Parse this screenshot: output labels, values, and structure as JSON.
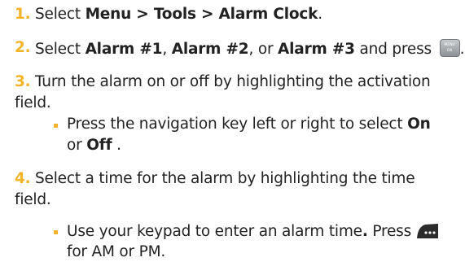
{
  "steps": [
    {
      "number": "1.",
      "pre": "Select ",
      "bold": "Menu > Tools > Alarm Clock",
      "post": "."
    },
    {
      "number": "2.",
      "t1": "Select ",
      "b1": "Alarm #1",
      "t2": ", ",
      "b2": "Alarm #2",
      "t3": ", or ",
      "b3": "Alarm #3",
      "t4": " and press ",
      "t5": ".",
      "key_icon": "menu-ok-key-icon",
      "key_top": "MENU",
      "key_bottom": "OK"
    },
    {
      "number": "3.",
      "lines": [
        "Turn the alarm on or off by highlighting the activation",
        "field."
      ],
      "bullet": {
        "line1": "Press the navigation key left or right to select ",
        "b_on": "On",
        "or": "or ",
        "b_off": "Off",
        "end": " ."
      }
    },
    {
      "number": "4.",
      "lines": [
        "Select a time for the alarm by highlighting the time",
        "field."
      ],
      "bullet": {
        "pre": "Use your keypad to enter an alarm time",
        "dot": ".",
        "press": " Press",
        "key_icon": "soft-key-icon",
        "line2": "for AM or PM."
      }
    }
  ],
  "colors": {
    "step_number": "#f3b32a",
    "bullet": "#f3b32a",
    "text": "#222222"
  }
}
